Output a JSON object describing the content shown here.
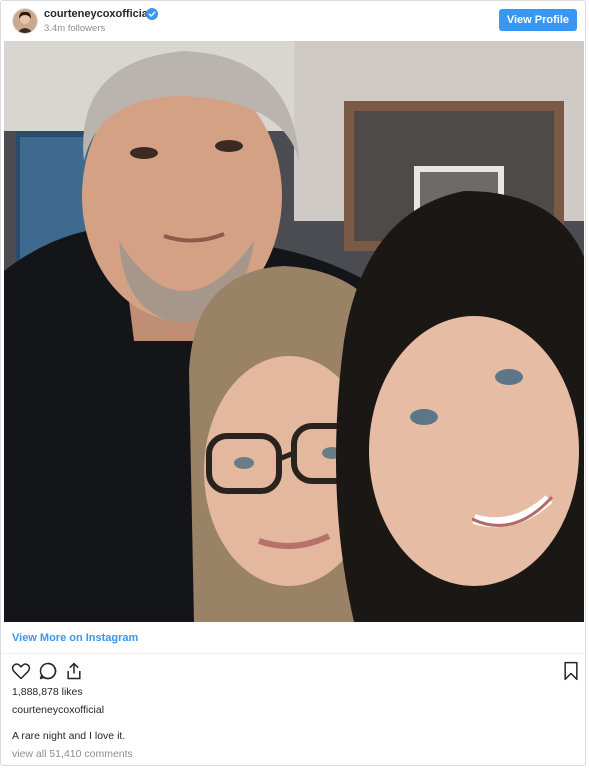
{
  "header": {
    "username": "courteneycoxofficial",
    "followers": "3.4m followers",
    "view_profile_label": "View Profile",
    "verified_icon": "verified-badge-icon"
  },
  "photo": {
    "content": "selfie of three people"
  },
  "links": {
    "view_more": "View More on Instagram"
  },
  "actions": {
    "icons": [
      "heart-icon",
      "comment-icon",
      "share-icon",
      "bookmark-icon"
    ]
  },
  "post": {
    "likes": "1,888,878 likes",
    "caption_user": "courteneycoxofficial",
    "caption": "A rare night and I love it.",
    "comments_link": "view all 51,410 comments"
  },
  "colors": {
    "accent": "#3897f0",
    "text": "#262626",
    "muted": "#8e8e8e",
    "border": "#dbdbdb"
  }
}
